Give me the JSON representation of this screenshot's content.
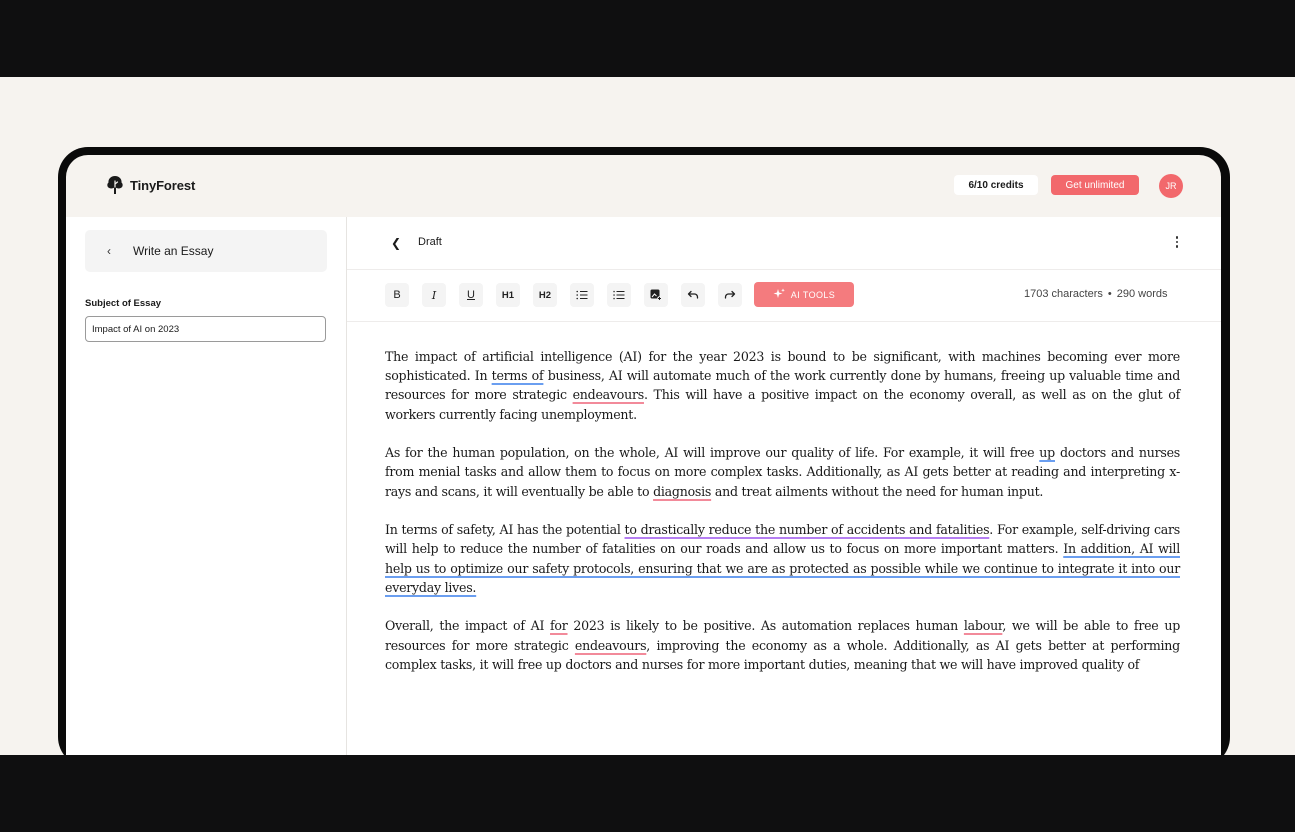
{
  "app": {
    "name": "TinyForest",
    "credits": "6/10 credits",
    "get_unlimited": "Get unlimited",
    "avatar_initials": "JR",
    "accent_color": "#f2686c"
  },
  "sidebar": {
    "back_label": "Write an Essay",
    "subject_label": "Subject of Essay",
    "subject_value": "Impact of AI on 2023"
  },
  "editor": {
    "title": "Draft",
    "toolbar": {
      "bold": "B",
      "italic": "I",
      "underline": "U",
      "h1": "H1",
      "h2": "H2",
      "ai_tools": "AI TOOLS",
      "icons": [
        "numbered-list-icon",
        "bullet-list-icon",
        "image-add-icon",
        "undo-icon",
        "redo-icon"
      ]
    },
    "characters": "1703 characters",
    "words": "290 words"
  },
  "essay": {
    "p1": [
      {
        "t": "The impact of artificial intelligence (AI) for the year 2023 is bound to be significant, with machines becoming ever more sophisticated. In "
      },
      {
        "t": "terms of",
        "s": "blue"
      },
      {
        "t": " business, AI will automate much of the work currently done by humans, freeing up valuable time and resources for more strategic "
      },
      {
        "t": "endeavours",
        "s": "red"
      },
      {
        "t": ". This will have a positive impact on the economy overall, as well as on the glut of workers currently facing unemployment."
      }
    ],
    "p2": [
      {
        "t": "As for the human population, on the whole, AI will improve our quality of life. For example, it will free "
      },
      {
        "t": "up",
        "s": "blue"
      },
      {
        "t": " doctors and nurses from menial tasks and allow them to focus on more complex tasks. Additionally, as AI gets better at reading and interpreting x-rays and scans, it will eventually be able to "
      },
      {
        "t": "diagnosis",
        "s": "red"
      },
      {
        "t": " and treat ailments without the need for human input."
      }
    ],
    "p3": [
      {
        "t": "In terms of safety, AI has the potential "
      },
      {
        "t": "to drastically reduce the number of accidents and fatalities",
        "s": "purple"
      },
      {
        "t": ". For example, self-driving cars will help to reduce the number of fatalities on our roads and allow us to focus on more important matters. "
      },
      {
        "t": "In addition, AI will help us to optimize our safety protocols, ensuring that we are as protected as possible while we continue to integrate it into our everyday lives.",
        "s": "blue"
      }
    ],
    "p4": [
      {
        "t": "Overall, the impact of AI "
      },
      {
        "t": "for",
        "s": "red"
      },
      {
        "t": " 2023 is likely to be positive. As automation replaces human "
      },
      {
        "t": "labour",
        "s": "red"
      },
      {
        "t": ", we will be able to free up resources for more strategic "
      },
      {
        "t": "endeavours",
        "s": "red"
      },
      {
        "t": ", improving the economy as a whole. Additionally, as AI gets better at performing complex tasks, it will free up doctors and nurses for more important duties, meaning that we will have improved quality of"
      }
    ]
  }
}
